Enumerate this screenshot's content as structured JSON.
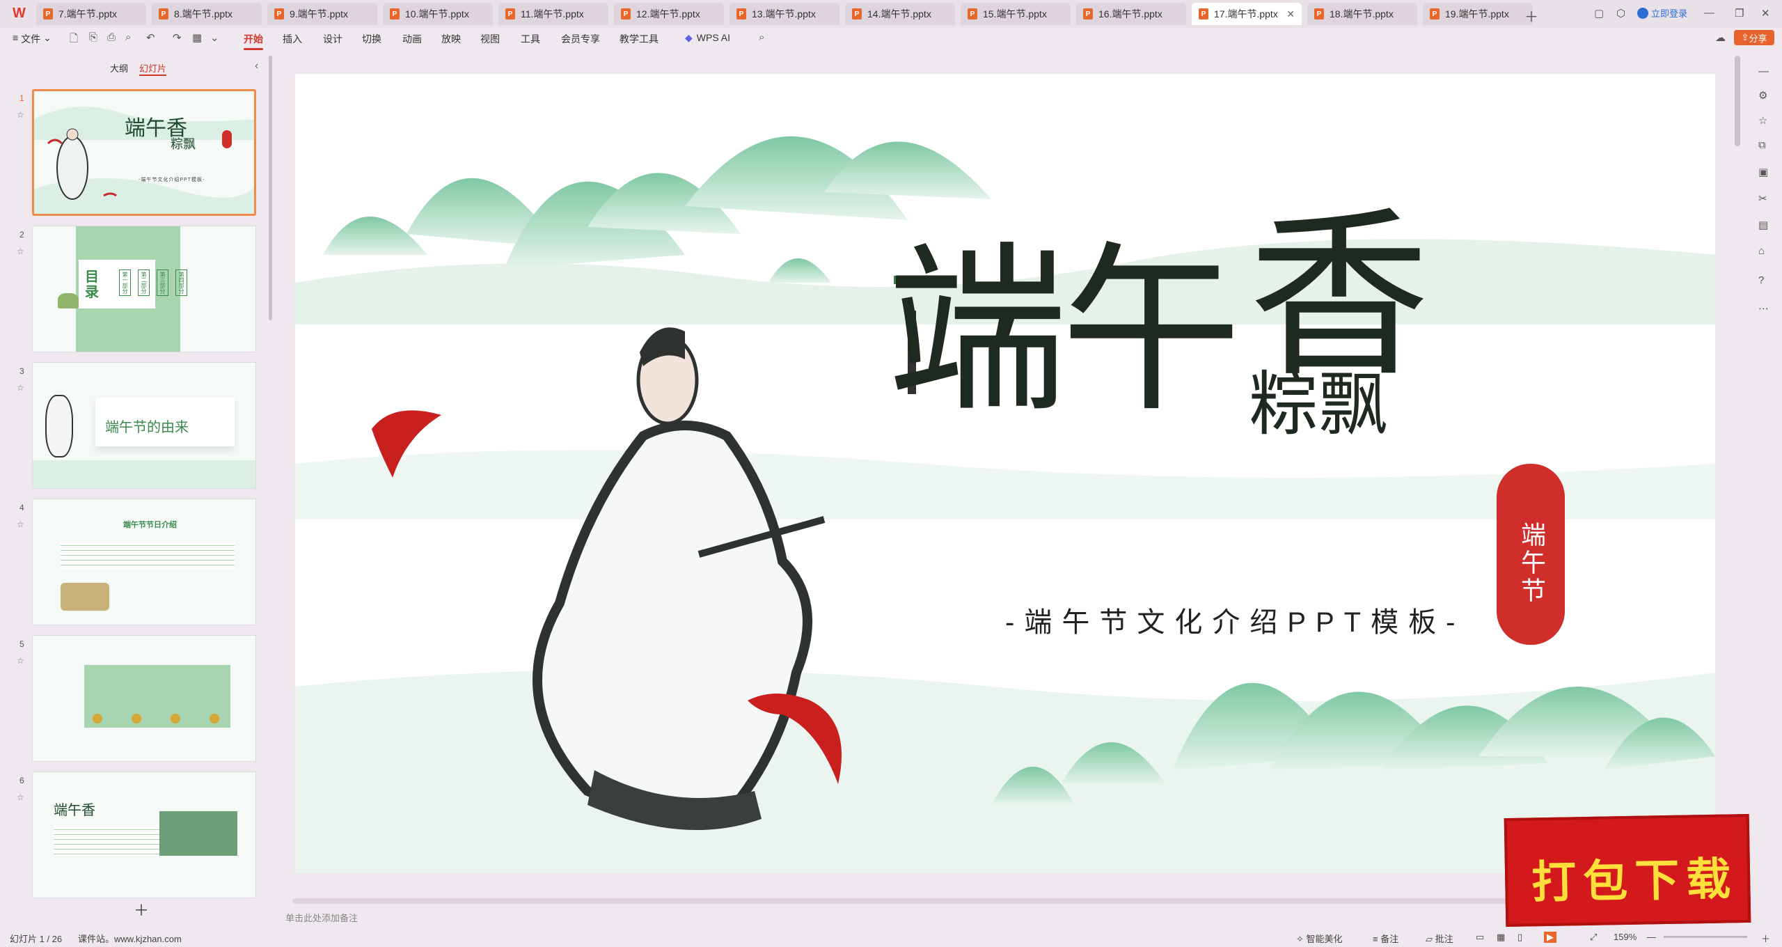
{
  "tabs": [
    "7.端午节.pptx",
    "8.端午节.pptx",
    "9.端午节.pptx",
    "10.端午节.pptx",
    "11.端午节.pptx",
    "12.端午节.pptx",
    "13.端午节.pptx",
    "14.端午节.pptx",
    "15.端午节.pptx",
    "16.端午节.pptx",
    "17.端午节.pptx",
    "18.端午节.pptx",
    "19.端午节.pptx"
  ],
  "active_tab_index": 10,
  "login": "立即登录",
  "menu": {
    "file": "文件",
    "items": [
      "开始",
      "插入",
      "设计",
      "切换",
      "动画",
      "放映",
      "视图",
      "工具",
      "会员专享",
      "教学工具"
    ],
    "active": "开始",
    "wps_ai": "WPS AI",
    "share": "分享"
  },
  "panel": {
    "outline": "大纲",
    "slides": "幻灯片"
  },
  "thumbnails": [
    {
      "num": "1",
      "title": "端午香",
      "title2": "粽飘",
      "sub": "-端午节文化介绍PPT模板-"
    },
    {
      "num": "2",
      "title": "目录",
      "items": [
        "第一部分",
        "第二部分",
        "第三部分",
        "第四部分"
      ]
    },
    {
      "num": "3",
      "title": "端午节的由来"
    },
    {
      "num": "4",
      "title": "端午节节日介绍"
    },
    {
      "num": "5",
      "title": ""
    },
    {
      "num": "6",
      "title": "端午香"
    }
  ],
  "slide": {
    "title_a": "端午",
    "title_b": "香",
    "title_c": "粽飘",
    "subtitle": "-端午节文化介绍PPT模板-",
    "seal": "端午节"
  },
  "notes_placeholder": "单击此处添加备注",
  "status": {
    "slide_count": "幻灯片 1 / 26",
    "site": "课件站。www.kjzhan.com",
    "smart": "智能美化",
    "notes": "备注",
    "comment": "批注",
    "zoom": "159%"
  },
  "promo": "打包下载"
}
